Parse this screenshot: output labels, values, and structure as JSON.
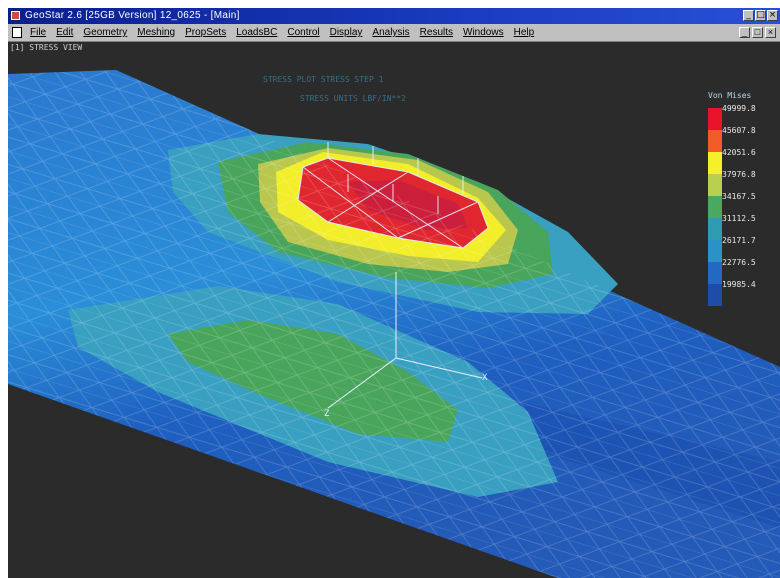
{
  "window": {
    "title": "GeoStar 2.6 [25GB Version] 12_0625 - [Main]"
  },
  "menu": {
    "items": [
      "File",
      "Edit",
      "Geometry",
      "Meshing",
      "PropSets",
      "LoadsBC",
      "Control",
      "Display",
      "Analysis",
      "Results",
      "Windows",
      "Help"
    ]
  },
  "viewport": {
    "tag": "[1] STRESS VIEW",
    "plot_line1": "STRESS PLOT STRESS STEP 1",
    "plot_line2": "STRESS UNITS LBF/IN**2",
    "axis_labels": {
      "x": "X",
      "z": "Z"
    },
    "legend": {
      "title": "Von Mises",
      "values": [
        "49999.8",
        "45607.8",
        "42051.6",
        "37976.8",
        "34167.5",
        "31112.5",
        "26171.7",
        "22776.5",
        "19985.4"
      ],
      "colors": [
        "#e8142a",
        "#f25a28",
        "#f6f02a",
        "#b8cf52",
        "#4aa861",
        "#2f9bb1",
        "#2b92c8",
        "#2468c2",
        "#1f4ca8"
      ]
    }
  }
}
